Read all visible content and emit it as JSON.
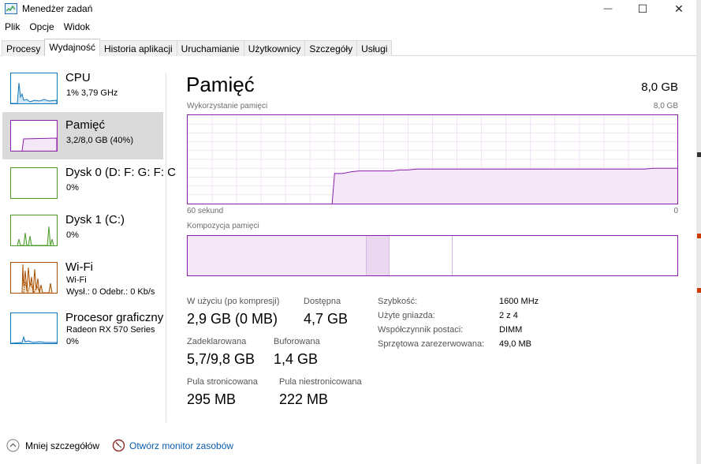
{
  "window": {
    "title": "Menedżer zadań",
    "controls": {
      "minimize": "—",
      "maximize": "☐",
      "close": "✕"
    }
  },
  "menu": [
    "Plik",
    "Opcje",
    "Widok"
  ],
  "tabs": [
    {
      "label": "Procesy",
      "active": false
    },
    {
      "label": "Wydajność",
      "active": true
    },
    {
      "label": "Historia aplikacji",
      "active": false
    },
    {
      "label": "Uruchamianie",
      "active": false
    },
    {
      "label": "Użytkownicy",
      "active": false
    },
    {
      "label": "Szczegóły",
      "active": false
    },
    {
      "label": "Usługi",
      "active": false
    }
  ],
  "sidebar": [
    {
      "name": "CPU",
      "sub1": "1% 3,79 GHz",
      "sub2": "",
      "color": "#1177bb",
      "selected": false
    },
    {
      "name": "Pamięć",
      "sub1": "3,2/8,0 GB (40%)",
      "sub2": "",
      "color": "#8b1fa9",
      "selected": true
    },
    {
      "name": "Dysk 0 (D: F: G: F: C",
      "sub1": "0%",
      "sub2": "",
      "color": "#4c9a2a",
      "selected": false
    },
    {
      "name": "Dysk 1 (C:)",
      "sub1": "0%",
      "sub2": "",
      "color": "#4c9a2a",
      "selected": false
    },
    {
      "name": "Wi-Fi",
      "sub1": "Wi-Fi",
      "sub2": "Wysł.: 0 Odebr.: 0 Kb/s",
      "color": "#a74f01",
      "selected": false
    },
    {
      "name": "Procesor graficzny",
      "sub1": "Radeon RX 570 Series",
      "sub2": "0%",
      "color": "#1177bb",
      "selected": false
    }
  ],
  "main": {
    "title": "Pamięć",
    "total": "8,0 GB",
    "usage_label": "Wykorzystanie pamięci",
    "usage_max": "8,0 GB",
    "time_label": "60 sekund",
    "time_end": "0",
    "composition_label": "Kompozycja pamięci",
    "accent": "#8b1fa9",
    "usage_history_fraction": [
      0,
      0,
      0,
      0,
      0,
      0,
      0,
      0,
      0,
      0,
      0,
      0,
      0,
      0,
      0,
      0,
      0,
      0,
      0.34,
      0.34,
      0.36,
      0.37,
      0.37,
      0.37,
      0.37,
      0.37,
      0.38,
      0.38,
      0.39,
      0.39,
      0.39,
      0.39,
      0.39,
      0.39,
      0.39,
      0.39,
      0.39,
      0.39,
      0.39,
      0.39,
      0.39,
      0.39,
      0.39,
      0.39,
      0.39,
      0.39,
      0.39,
      0.39,
      0.39,
      0.39,
      0.39,
      0.39,
      0.39,
      0.39,
      0.39,
      0.39,
      0.39,
      0.4,
      0.4,
      0.4,
      0.4
    ]
  },
  "stats": {
    "in_use_label": "W użyciu (po kompresji)",
    "in_use": "2,9 GB (0 MB)",
    "available_label": "Dostępna",
    "available": "4,7 GB",
    "committed_label": "Zadeklarowana",
    "committed": "5,7/9,8 GB",
    "cached_label": "Buforowana",
    "cached": "1,4 GB",
    "paged_label": "Pula stronicowana",
    "paged": "295 MB",
    "nonpaged_label": "Pula niestronicowana",
    "nonpaged": "222 MB"
  },
  "specs": [
    {
      "label": "Szybkość:",
      "value": "1600 MHz"
    },
    {
      "label": "Użyte gniazda:",
      "value": "2 z 4"
    },
    {
      "label": "Współczynnik postaci:",
      "value": "DIMM"
    },
    {
      "label": "Sprzętowa zarezerwowana:",
      "value": "49,0 MB"
    }
  ],
  "footer": {
    "less_details": "Mniej szczegółów",
    "resource_monitor": "Otwórz monitor zasobów"
  }
}
